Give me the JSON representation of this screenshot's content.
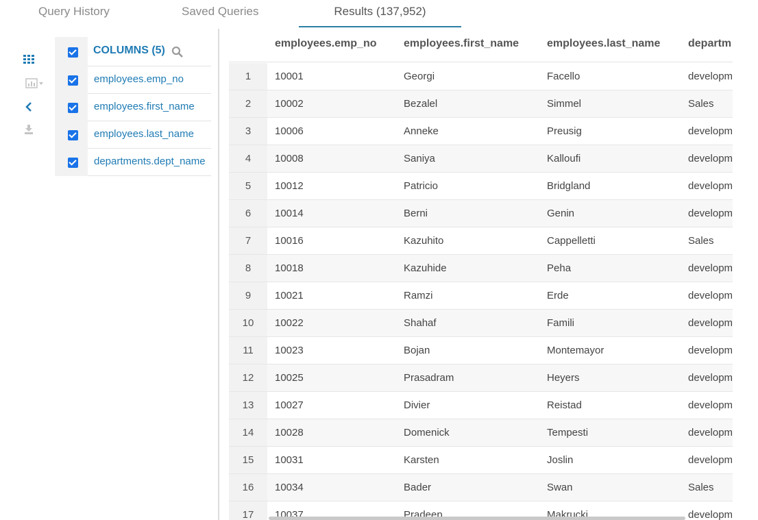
{
  "tabs": [
    {
      "label": "Query History"
    },
    {
      "label": "Saved Queries"
    },
    {
      "label": "Results (137,952)"
    }
  ],
  "columns_panel": {
    "title": "COLUMNS (5)",
    "items": [
      {
        "label": "employees.emp_no"
      },
      {
        "label": "employees.first_name"
      },
      {
        "label": "employees.last_name"
      },
      {
        "label": "departments.dept_name"
      }
    ]
  },
  "grid": {
    "headers": [
      "employees.emp_no",
      "employees.first_name",
      "employees.last_name",
      "departm"
    ],
    "rows": [
      [
        "1",
        "10001",
        "Georgi",
        "Facello",
        "developm"
      ],
      [
        "2",
        "10002",
        "Bezalel",
        "Simmel",
        "Sales"
      ],
      [
        "3",
        "10006",
        "Anneke",
        "Preusig",
        "developm"
      ],
      [
        "4",
        "10008",
        "Saniya",
        "Kalloufi",
        "developm"
      ],
      [
        "5",
        "10012",
        "Patricio",
        "Bridgland",
        "developm"
      ],
      [
        "6",
        "10014",
        "Berni",
        "Genin",
        "developm"
      ],
      [
        "7",
        "10016",
        "Kazuhito",
        "Cappelletti",
        "Sales"
      ],
      [
        "8",
        "10018",
        "Kazuhide",
        "Peha",
        "developm"
      ],
      [
        "9",
        "10021",
        "Ramzi",
        "Erde",
        "developm"
      ],
      [
        "10",
        "10022",
        "Shahaf",
        "Famili",
        "developm"
      ],
      [
        "11",
        "10023",
        "Bojan",
        "Montemayor",
        "developm"
      ],
      [
        "12",
        "10025",
        "Prasadram",
        "Heyers",
        "developm"
      ],
      [
        "13",
        "10027",
        "Divier",
        "Reistad",
        "developm"
      ],
      [
        "14",
        "10028",
        "Domenick",
        "Tempesti",
        "developm"
      ],
      [
        "15",
        "10031",
        "Karsten",
        "Joslin",
        "developm"
      ],
      [
        "16",
        "10034",
        "Bader",
        "Swan",
        "Sales"
      ],
      [
        "17",
        "10037",
        "Pradeep",
        "Makrucki",
        "developm"
      ]
    ]
  },
  "icons": {
    "grid_view": "grid-icon",
    "chart": "bar-chart-icon",
    "collapse": "chevron-left-icon",
    "download": "download-icon",
    "search": "search-icon"
  },
  "colors": {
    "accent": "#1f7bb4",
    "checkbox": "#1a73e8"
  }
}
